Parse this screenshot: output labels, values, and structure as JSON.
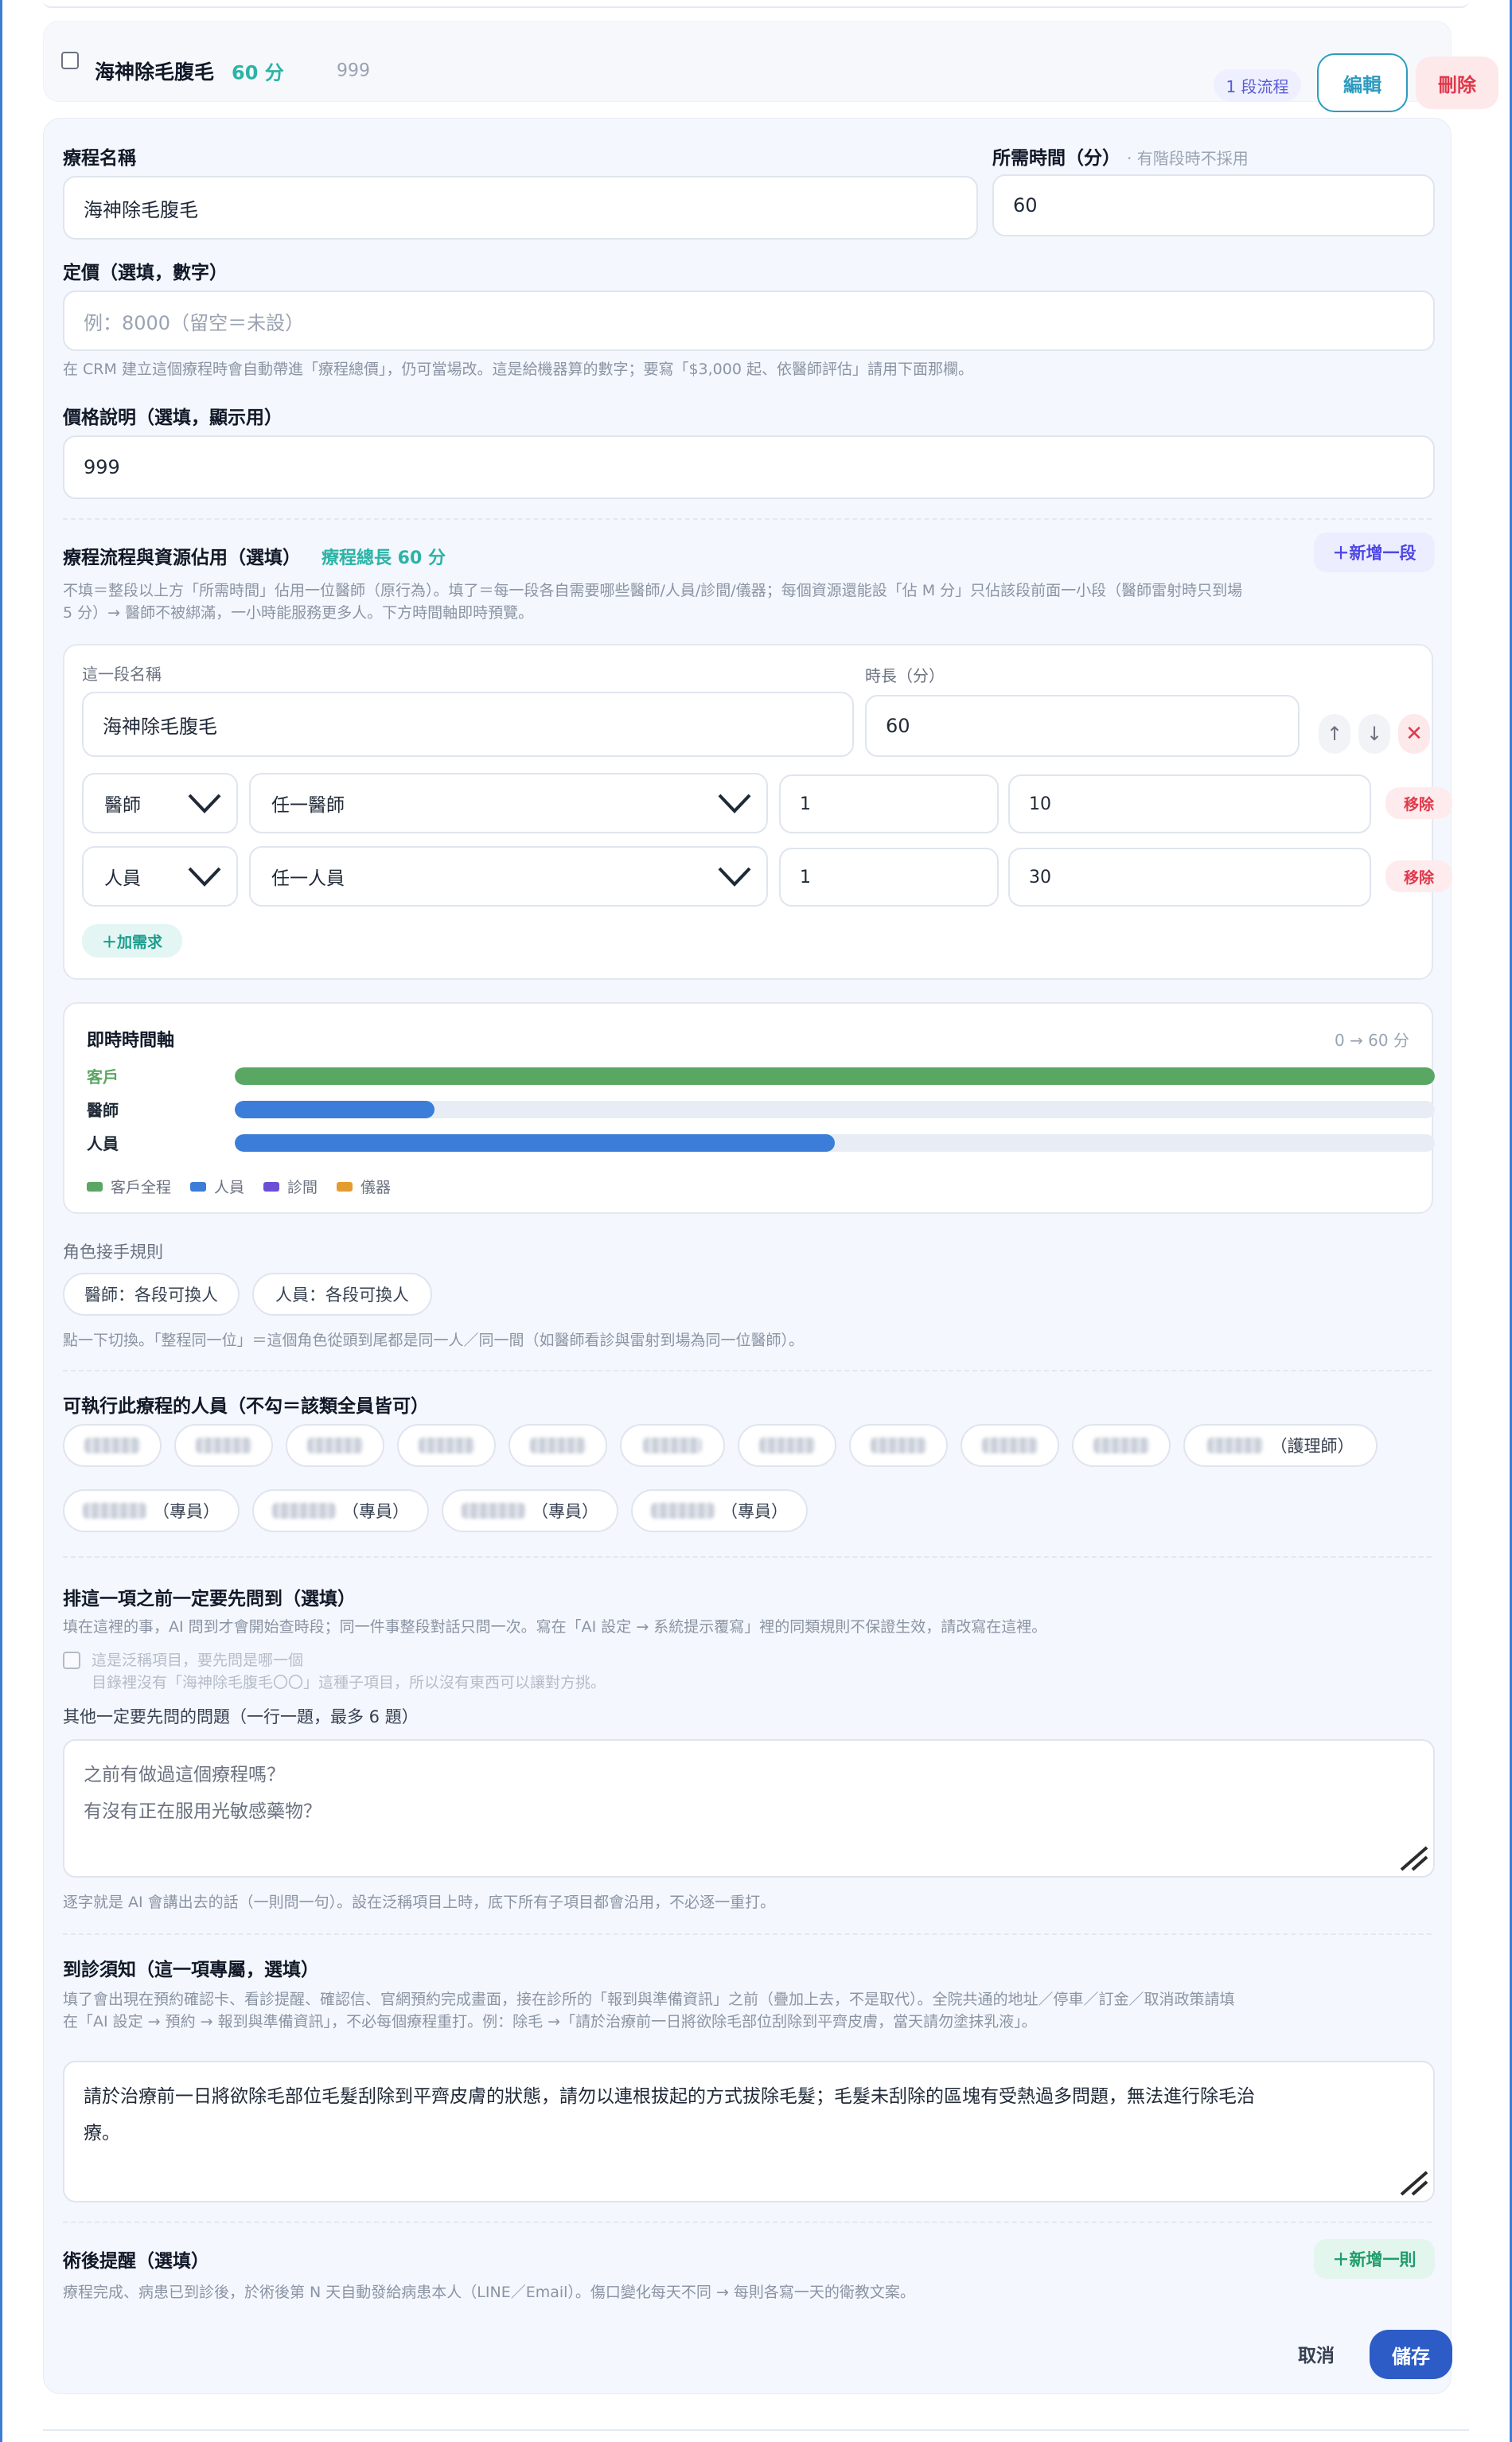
{
  "row": {
    "name": "海神除毛腹毛",
    "minutes": "60 分",
    "price": "999",
    "step_badge": "1 段流程",
    "edit_label": "編輯",
    "delete_label": "刪除"
  },
  "form": {
    "name_label": "療程名稱",
    "name_value": "海神除毛腹毛",
    "time_label": "所需時間（分）",
    "time_note": "· 有階段時不採用",
    "time_value": "60",
    "price_label": "定價（選填，數字）",
    "price_placeholder": "例：8000（留空＝未設）",
    "price_help": "在 CRM 建立這個療程時會自動帶進「療程總價」，仍可當場改。這是給機器算的數字；要寫「$3,000 起、依醫師評估」請用下面那欄。",
    "price_desc_label": "價格說明（選填，顯示用）",
    "price_desc_value": "999"
  },
  "flow": {
    "title": "療程流程與資源佔用（選填）",
    "total": "療程總長 60 分",
    "add_segment": "＋新增一段",
    "help_1": "不填＝整段以上方「所需時間」佔用一位醫師（原行為）。填了＝每一段各自需要哪些醫師/人員/診間/儀器；每個資源還能設「佔 M 分」只佔該段前面一小段（醫師雷射時只到場",
    "help_2": "5 分）→ 醫師不被綁滿，一小時能服務更多人。下方時間軸即時預覽。",
    "segment": {
      "name_label": "這一段名稱",
      "name_value": "海神除毛腹毛",
      "dur_label": "時長（分）",
      "dur_value": "60",
      "up": "↑",
      "down": "↓",
      "close": "✕",
      "requirements": [
        {
          "type": "醫師",
          "who": "任一醫師",
          "count": "1",
          "minutes": "10",
          "remove": "移除"
        },
        {
          "type": "人員",
          "who": "任一人員",
          "count": "1",
          "minutes": "30",
          "remove": "移除"
        }
      ],
      "add_req": "＋加需求"
    }
  },
  "timeline": {
    "title": "即時時間軸",
    "range": "0 → 60 分",
    "rows": [
      {
        "label": "客戶",
        "color": "#5aa763",
        "fraction": 1.0
      },
      {
        "label": "醫師",
        "color": "#3b7dd8",
        "fraction": 0.1667
      },
      {
        "label": "人員",
        "color": "#3b7dd8",
        "fraction": 0.5
      }
    ],
    "legend": [
      {
        "label": "客戶全程",
        "color": "#5aa763"
      },
      {
        "label": "人員",
        "color": "#3b7dd8"
      },
      {
        "label": "診間",
        "color": "#6c4fd6"
      },
      {
        "label": "儀器",
        "color": "#e49b2f"
      }
    ]
  },
  "handoff": {
    "title": "角色接手規則",
    "chips": [
      "醫師：各段可換人",
      "人員：各段可換人"
    ],
    "help": "點一下切換。「整程同一位」＝這個角色從頭到尾都是同一人／同一間（如醫師看診與雷射到場為同一位醫師）。"
  },
  "staff": {
    "title": "可執行此療程的人員（不勾＝該類全員皆可）",
    "row1_suffix": "（護理師）",
    "row2_suffixes": [
      "（專員）",
      "（專員）",
      "（專員）",
      "（專員）"
    ]
  },
  "preask": {
    "title": "排這一項之前一定要先問到（選填）",
    "help": "填在這裡的事，AI 問到才會開始查時段；同一件事整段對話只問一次。寫在「AI 設定 → 系統提示覆寫」裡的同類規則不保證生效，請改寫在這裡。",
    "check_label": "這是泛稱項目，要先問是哪一個",
    "check_help": "目錄裡沒有「海神除毛腹毛〇〇」這種子項目，所以沒有東西可以讓對方挑。",
    "other_label": "其他一定要先問的問題（一行一題，最多 6 題）",
    "q1": "之前有做過這個療程嗎？",
    "q2": "有沒有正在服用光敏感藥物？",
    "footer": "逐字就是 AI 會講出去的話（一則問一句）。設在泛稱項目上時，底下所有子項目都會沿用，不必逐一重打。"
  },
  "notice": {
    "title": "到診須知（這一項專屬，選填）",
    "help_1": "填了會出現在預約確認卡、看診提醒、確認信、官網預約完成畫面，接在診所的「報到與準備資訊」之前（疊加上去，不是取代）。全院共通的地址／停車／訂金／取消政策請填",
    "help_2": "在「AI 設定 → 預約 → 報到與準備資訊」，不必每個療程重打。例：除毛 →「請於治療前一日將欲除毛部位刮除到平齊皮膚，當天請勿塗抹乳液」。",
    "line1": "請於治療前一日將欲除毛部位毛髮刮除到平齊皮膚的狀態，請勿以連根拔起的方式拔除毛髮；毛髮未刮除的區塊有受熱過多問題，無法進行除毛治",
    "line2": "療。"
  },
  "aftercare": {
    "title": "術後提醒（選填）",
    "add": "＋新增一則",
    "help": "療程完成、病患已到診後，於術後第 N 天自動發給病患本人（LINE／Email）。傷口變化每天不同 → 每則各寫一天的衛教文案。"
  },
  "actions": {
    "cancel": "取消",
    "save": "儲存"
  },
  "colors": {
    "accent": "#2d5cc7",
    "teal": "#2bb3a6",
    "danger": "#e0384a"
  }
}
